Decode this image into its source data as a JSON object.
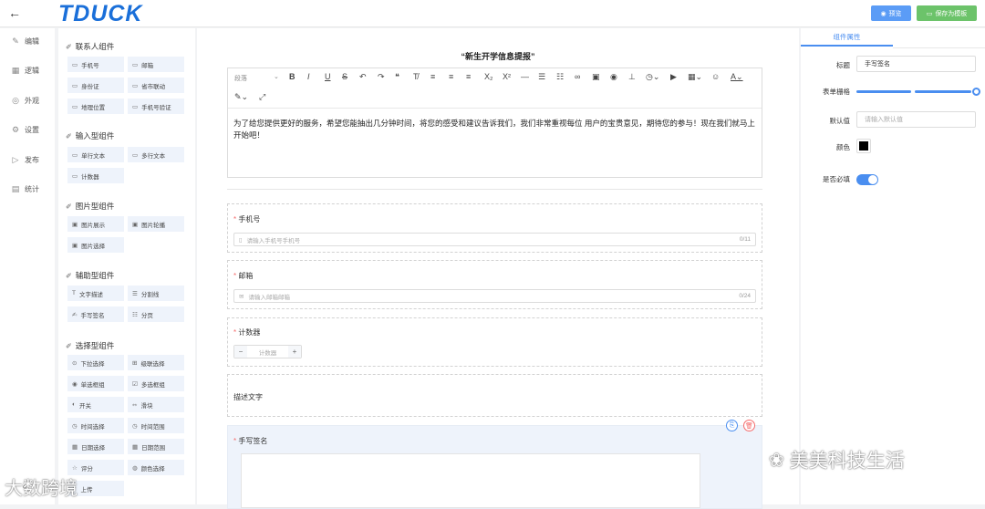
{
  "topbar": {
    "back_icon": "arrow-left-icon",
    "logo": "TDUCK",
    "preview_label": "预览",
    "save_template_label": "保存为模板",
    "colors": {
      "preview": "#5b9cf6",
      "save": "#6cc36a",
      "brand": "#1a6fd9"
    }
  },
  "nav": {
    "items": [
      {
        "label": "编辑",
        "icon": "edit-icon"
      },
      {
        "label": "逻辑",
        "icon": "grid-icon"
      },
      {
        "label": "外观",
        "icon": "eye-icon"
      },
      {
        "label": "设置",
        "icon": "gear-icon"
      },
      {
        "label": "发布",
        "icon": "publish-icon"
      },
      {
        "label": "统计",
        "icon": "chart-icon"
      }
    ],
    "collapse_icon": "double-chevron-left-icon"
  },
  "palette": {
    "groups": [
      {
        "title": "联系人组件",
        "items": [
          "手机号",
          "邮箱",
          "身份证",
          "省市联动",
          "地理位置",
          "手机号验证"
        ]
      },
      {
        "title": "输入型组件",
        "items": [
          "单行文本",
          "多行文本",
          "计数器"
        ]
      },
      {
        "title": "图片型组件",
        "items": [
          "图片展示",
          "图片轮播",
          "图片选择"
        ]
      },
      {
        "title": "辅助型组件",
        "items": [
          "文字描述",
          "分割线",
          "手写签名",
          "分页"
        ]
      },
      {
        "title": "选择型组件",
        "items": [
          "下拉选择",
          "级联选择",
          "单选框组",
          "多选框组",
          "开关",
          "滑块",
          "时间选择",
          "时间范围",
          "日期选择",
          "日期范围",
          "评分",
          "颜色选择"
        ]
      }
    ],
    "partial_item": "上传"
  },
  "canvas": {
    "form_title": "“新生开学信息提报”",
    "toolbar": {
      "paragraph": "段落"
    },
    "intro": "为了给您提供更好的服务，希望您能抽出几分钟时间，将您的感受和建议告诉我们，我们非常重视每位 用户的宝贵意见，期待您的参与！现在我们就马上开始吧！",
    "fields": {
      "phone": {
        "label": "手机号",
        "placeholder": "请输入手机号手机号",
        "count": "0/11"
      },
      "email": {
        "label": "邮箱",
        "placeholder": "请输入邮箱邮箱",
        "count": "0/24"
      },
      "counter": {
        "label": "计数器",
        "minus": "−",
        "value": "计数器",
        "plus": "+"
      },
      "desc": {
        "text": "描述文字"
      },
      "signature": {
        "label": "手写签名"
      }
    }
  },
  "props": {
    "tab": "组件属性",
    "title_label": "标题",
    "title_value": "手写签名",
    "grid_label": "表单栅格",
    "grid_value": 1.0,
    "default_label": "默认值",
    "default_placeholder": "请输入默认值",
    "color_label": "颜色",
    "color_value": "#000000",
    "required_label": "是否必填",
    "required_on": true
  },
  "watermarks": {
    "right": "美美科技生活",
    "left": "大数跨境"
  }
}
